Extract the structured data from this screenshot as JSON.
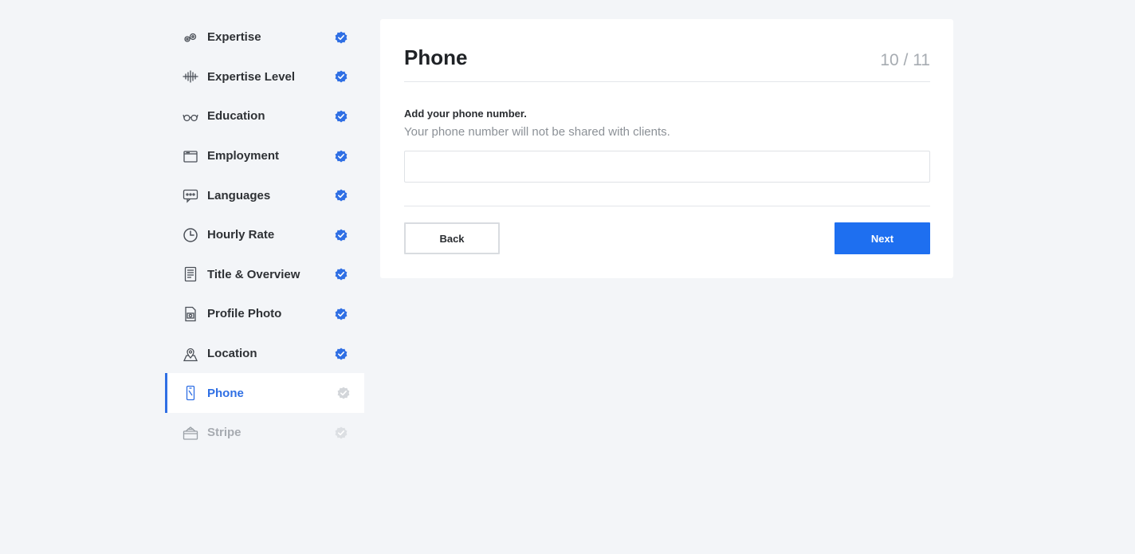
{
  "sidebar": {
    "steps": [
      {
        "label": "Expertise",
        "icon": "gears-icon",
        "status": "complete"
      },
      {
        "label": "Expertise Level",
        "icon": "waveform-icon",
        "status": "complete"
      },
      {
        "label": "Education",
        "icon": "glasses-icon",
        "status": "complete"
      },
      {
        "label": "Employment",
        "icon": "folder-icon",
        "status": "complete"
      },
      {
        "label": "Languages",
        "icon": "chat-bubble-icon",
        "status": "complete"
      },
      {
        "label": "Hourly Rate",
        "icon": "clock-icon",
        "status": "complete"
      },
      {
        "label": "Title & Overview",
        "icon": "document-icon",
        "status": "complete"
      },
      {
        "label": "Profile Photo",
        "icon": "photo-file-icon",
        "status": "complete"
      },
      {
        "label": "Location",
        "icon": "map-pin-icon",
        "status": "complete"
      },
      {
        "label": "Phone",
        "icon": "phone-icon",
        "status": "active"
      },
      {
        "label": "Stripe",
        "icon": "credit-card-icon",
        "status": "pending"
      }
    ]
  },
  "card": {
    "title": "Phone",
    "counter": "10 / 11",
    "field_label": "Add your phone number.",
    "field_help": "Your phone number will not be shared with clients.",
    "phone_value": "",
    "phone_placeholder": "",
    "back_label": "Back",
    "next_label": "Next"
  },
  "colors": {
    "accent": "#2f6fe4",
    "next_button": "#1e6ff0",
    "check_complete": "#2f6fe4",
    "check_pending": "#d3d6da",
    "background": "#f3f5f8"
  }
}
